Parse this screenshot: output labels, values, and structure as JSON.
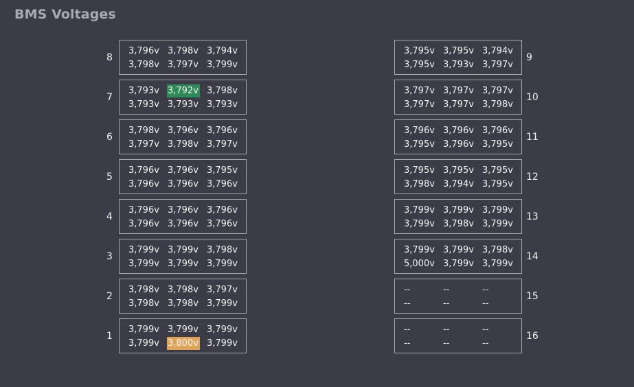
{
  "title": "BMS Voltages",
  "colors": {
    "background": "#3c3c49",
    "min_highlight": "#2e8b57",
    "max_highlight": "#e0a35a"
  },
  "left_modules": [
    {
      "number": "8",
      "rows": [
        [
          "3,796v",
          "3,798v",
          "3,794v"
        ],
        [
          "3,798v",
          "3,797v",
          "3,799v"
        ]
      ]
    },
    {
      "number": "7",
      "rows": [
        [
          "3,793v",
          "3,792v",
          "3,798v"
        ],
        [
          "3,793v",
          "3,793v",
          "3,793v"
        ]
      ]
    },
    {
      "number": "6",
      "rows": [
        [
          "3,798v",
          "3,796v",
          "3,796v"
        ],
        [
          "3,797v",
          "3,798v",
          "3,797v"
        ]
      ]
    },
    {
      "number": "5",
      "rows": [
        [
          "3,796v",
          "3,796v",
          "3,795v"
        ],
        [
          "3,796v",
          "3,796v",
          "3,796v"
        ]
      ]
    },
    {
      "number": "4",
      "rows": [
        [
          "3,796v",
          "3,796v",
          "3,796v"
        ],
        [
          "3,796v",
          "3,796v",
          "3,796v"
        ]
      ]
    },
    {
      "number": "3",
      "rows": [
        [
          "3,799v",
          "3,799v",
          "3,798v"
        ],
        [
          "3,799v",
          "3,799v",
          "3,799v"
        ]
      ]
    },
    {
      "number": "2",
      "rows": [
        [
          "3,798v",
          "3,798v",
          "3,797v"
        ],
        [
          "3,798v",
          "3,798v",
          "3,799v"
        ]
      ]
    },
    {
      "number": "1",
      "rows": [
        [
          "3,799v",
          "3,799v",
          "3,799v"
        ],
        [
          "3,799v",
          "3,800v",
          "3,799v"
        ]
      ]
    }
  ],
  "right_modules": [
    {
      "number": "9",
      "rows": [
        [
          "3,795v",
          "3,795v",
          "3,794v"
        ],
        [
          "3,795v",
          "3,793v",
          "3,797v"
        ]
      ]
    },
    {
      "number": "10",
      "rows": [
        [
          "3,797v",
          "3,797v",
          "3,797v"
        ],
        [
          "3,797v",
          "3,797v",
          "3,798v"
        ]
      ]
    },
    {
      "number": "11",
      "rows": [
        [
          "3,796v",
          "3,796v",
          "3,796v"
        ],
        [
          "3,795v",
          "3,796v",
          "3,795v"
        ]
      ]
    },
    {
      "number": "12",
      "rows": [
        [
          "3,795v",
          "3,795v",
          "3,795v"
        ],
        [
          "3,798v",
          "3,794v",
          "3,795v"
        ]
      ]
    },
    {
      "number": "13",
      "rows": [
        [
          "3,799v",
          "3,799v",
          "3,799v"
        ],
        [
          "3,799v",
          "3,798v",
          "3,799v"
        ]
      ]
    },
    {
      "number": "14",
      "rows": [
        [
          "3,799v",
          "3,799v",
          "3,798v"
        ],
        [
          "5,000v",
          "3,799v",
          "3,799v"
        ]
      ]
    },
    {
      "number": "15",
      "rows": [
        [
          "--",
          "--",
          "--"
        ],
        [
          "--",
          "--",
          "--"
        ]
      ]
    },
    {
      "number": "16",
      "rows": [
        [
          "--",
          "--",
          "--"
        ],
        [
          "--",
          "--",
          "--"
        ]
      ]
    }
  ],
  "highlights": {
    "min_cell": {
      "side": "left_modules",
      "module": 1,
      "row": 0,
      "col": 1
    },
    "max_cell": {
      "side": "left_modules",
      "module": 7,
      "row": 1,
      "col": 1
    }
  }
}
